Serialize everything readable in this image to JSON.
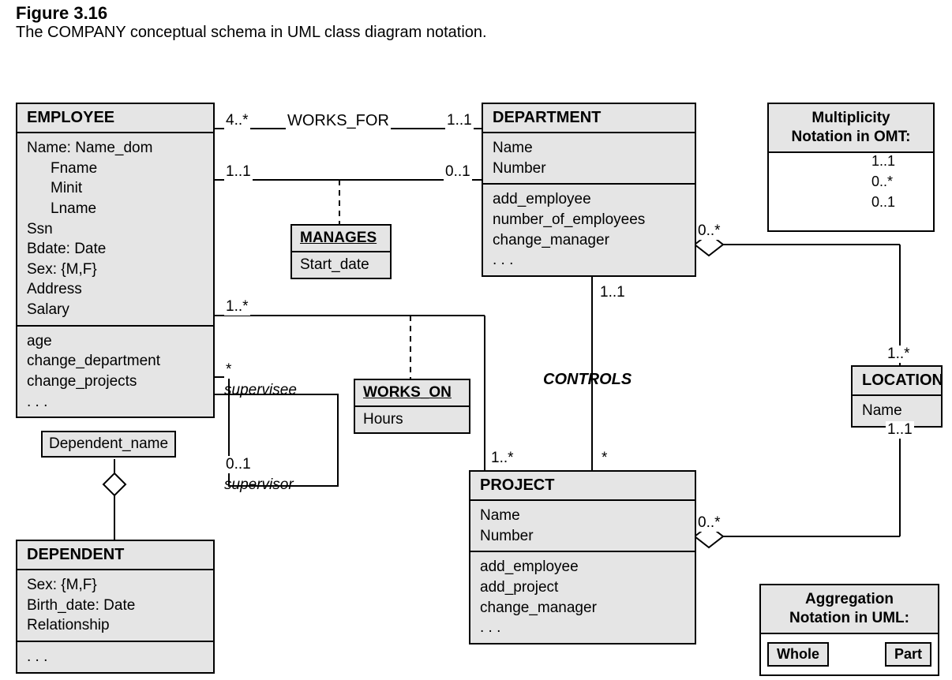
{
  "figure": {
    "number": "Figure 3.16",
    "caption": "The COMPANY conceptual schema in UML class diagram notation."
  },
  "employee": {
    "title": "EMPLOYEE",
    "attrs": {
      "name": "Name: Name_dom",
      "fname": "Fname",
      "minit": "Minit",
      "lname": "Lname",
      "ssn": "Ssn",
      "bdate": "Bdate: Date",
      "sex": "Sex: {M,F}",
      "address": "Address",
      "salary": "Salary"
    },
    "ops": {
      "age": "age",
      "chdept": "change_department",
      "chproj": "change_projects",
      "more": ". . ."
    }
  },
  "department": {
    "title": "DEPARTMENT",
    "attrs": {
      "name": "Name",
      "number": "Number"
    },
    "ops": {
      "add": "add_employee",
      "num": "number_of_employees",
      "chmgr": "change_manager",
      "more": ". . ."
    }
  },
  "project": {
    "title": "PROJECT",
    "attrs": {
      "name": "Name",
      "number": "Number"
    },
    "ops": {
      "add": "add_employee",
      "addp": "add_project",
      "chmgr": "change_manager",
      "more": ". . ."
    }
  },
  "dependent": {
    "title": "DEPENDENT",
    "attrs": {
      "sex": "Sex: {M,F}",
      "bdate": "Birth_date: Date",
      "rel": "Relationship"
    },
    "ops": {
      "more": ". . ."
    }
  },
  "location": {
    "title": "LOCATION",
    "attrs": {
      "name": "Name"
    }
  },
  "manages": {
    "title": "MANAGES",
    "attr": "Start_date"
  },
  "workson": {
    "title": "WORKS_ON",
    "attr": "Hours"
  },
  "qualifier": "Dependent_name",
  "rel": {
    "worksfor": {
      "name": "WORKS_FOR",
      "left": "4..*",
      "right": "1..1"
    },
    "manages": {
      "left": "1..1",
      "right": "0..1"
    },
    "workson": {
      "left": "1..*",
      "right": "*"
    },
    "controls": {
      "name": "CONTROLS",
      "top": "1..1",
      "bot": "1..*"
    },
    "supervises": {
      "svee": "supervisee",
      "svor": "supervisor",
      "eemult": "*",
      "ormult": "0..1"
    },
    "deptloc": {
      "top": "0..*",
      "bot": "1..*"
    },
    "projloc": {
      "top": "1..1",
      "bot": "0..*"
    }
  },
  "legend1": {
    "title1": "Multiplicity",
    "title2": "Notation in OMT:",
    "l1": "1..1",
    "l2": "0..*",
    "l3": "0..1"
  },
  "legend2": {
    "title1": "Aggregation",
    "title2": "Notation in UML:",
    "whole": "Whole",
    "part": "Part"
  }
}
